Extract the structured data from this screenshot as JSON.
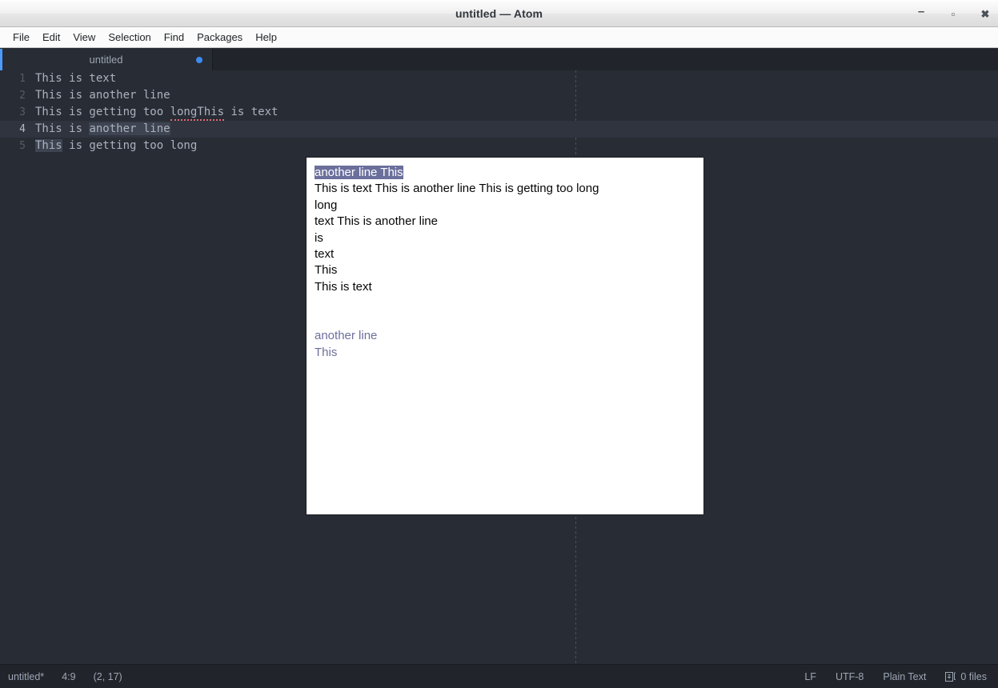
{
  "window": {
    "title": "untitled — Atom",
    "controls": [
      {
        "name": "minimize-button",
        "glyph": "–"
      },
      {
        "name": "maximize-button",
        "glyph": "▫"
      },
      {
        "name": "close-button",
        "glyph": "✖"
      }
    ]
  },
  "menubar": {
    "items": [
      {
        "label": "File"
      },
      {
        "label": "Edit"
      },
      {
        "label": "View"
      },
      {
        "label": "Selection"
      },
      {
        "label": "Find"
      },
      {
        "label": "Packages"
      },
      {
        "label": "Help"
      }
    ]
  },
  "tabs": [
    {
      "label": "untitled",
      "modified": true
    }
  ],
  "editor": {
    "lines": [
      {
        "number": "1",
        "active": false,
        "segments": [
          {
            "text": "This is text",
            "style": "plain"
          }
        ]
      },
      {
        "number": "2",
        "active": false,
        "segments": [
          {
            "text": "This is another line",
            "style": "plain"
          }
        ]
      },
      {
        "number": "3",
        "active": false,
        "segments": [
          {
            "text": "This is getting too ",
            "style": "plain"
          },
          {
            "text": "longThis",
            "style": "misspell"
          },
          {
            "text": " is text",
            "style": "plain"
          }
        ]
      },
      {
        "number": "4",
        "active": true,
        "segments": [
          {
            "text": "This is ",
            "style": "plain"
          },
          {
            "text": "another line",
            "style": "selected"
          }
        ]
      },
      {
        "number": "5",
        "active": false,
        "segments": [
          {
            "text": "This",
            "style": "selected"
          },
          {
            "text": " is getting too long",
            "style": "plain"
          }
        ]
      }
    ]
  },
  "popup": {
    "lines": [
      {
        "type": "highlight",
        "text": "another line This"
      },
      {
        "type": "normal",
        "text": "This is text This is another line This is getting too long"
      },
      {
        "type": "normal",
        "text": "long"
      },
      {
        "type": "normal",
        "text": "text This is another line"
      },
      {
        "type": "normal",
        "text": "is"
      },
      {
        "type": "normal",
        "text": "text"
      },
      {
        "type": "normal",
        "text": "This"
      },
      {
        "type": "normal",
        "text": "This is text"
      },
      {
        "type": "gap",
        "text": ""
      },
      {
        "type": "muted",
        "text": "another line"
      },
      {
        "type": "muted",
        "text": "This"
      }
    ]
  },
  "statusbar": {
    "filename": "untitled*",
    "position": "4:9",
    "selection": "(2, 17)",
    "line_ending": "LF",
    "encoding": "UTF-8",
    "grammar": "Plain Text",
    "git_changes": "0 files"
  },
  "colors": {
    "accent": "#4d9aff",
    "editor_bg": "#282c34",
    "chrome_bg": "#21252b",
    "text": "#abb2bf",
    "selection": "#3e4451",
    "popup_highlight": "#6b6f9c",
    "misspell": "#e06c75"
  }
}
